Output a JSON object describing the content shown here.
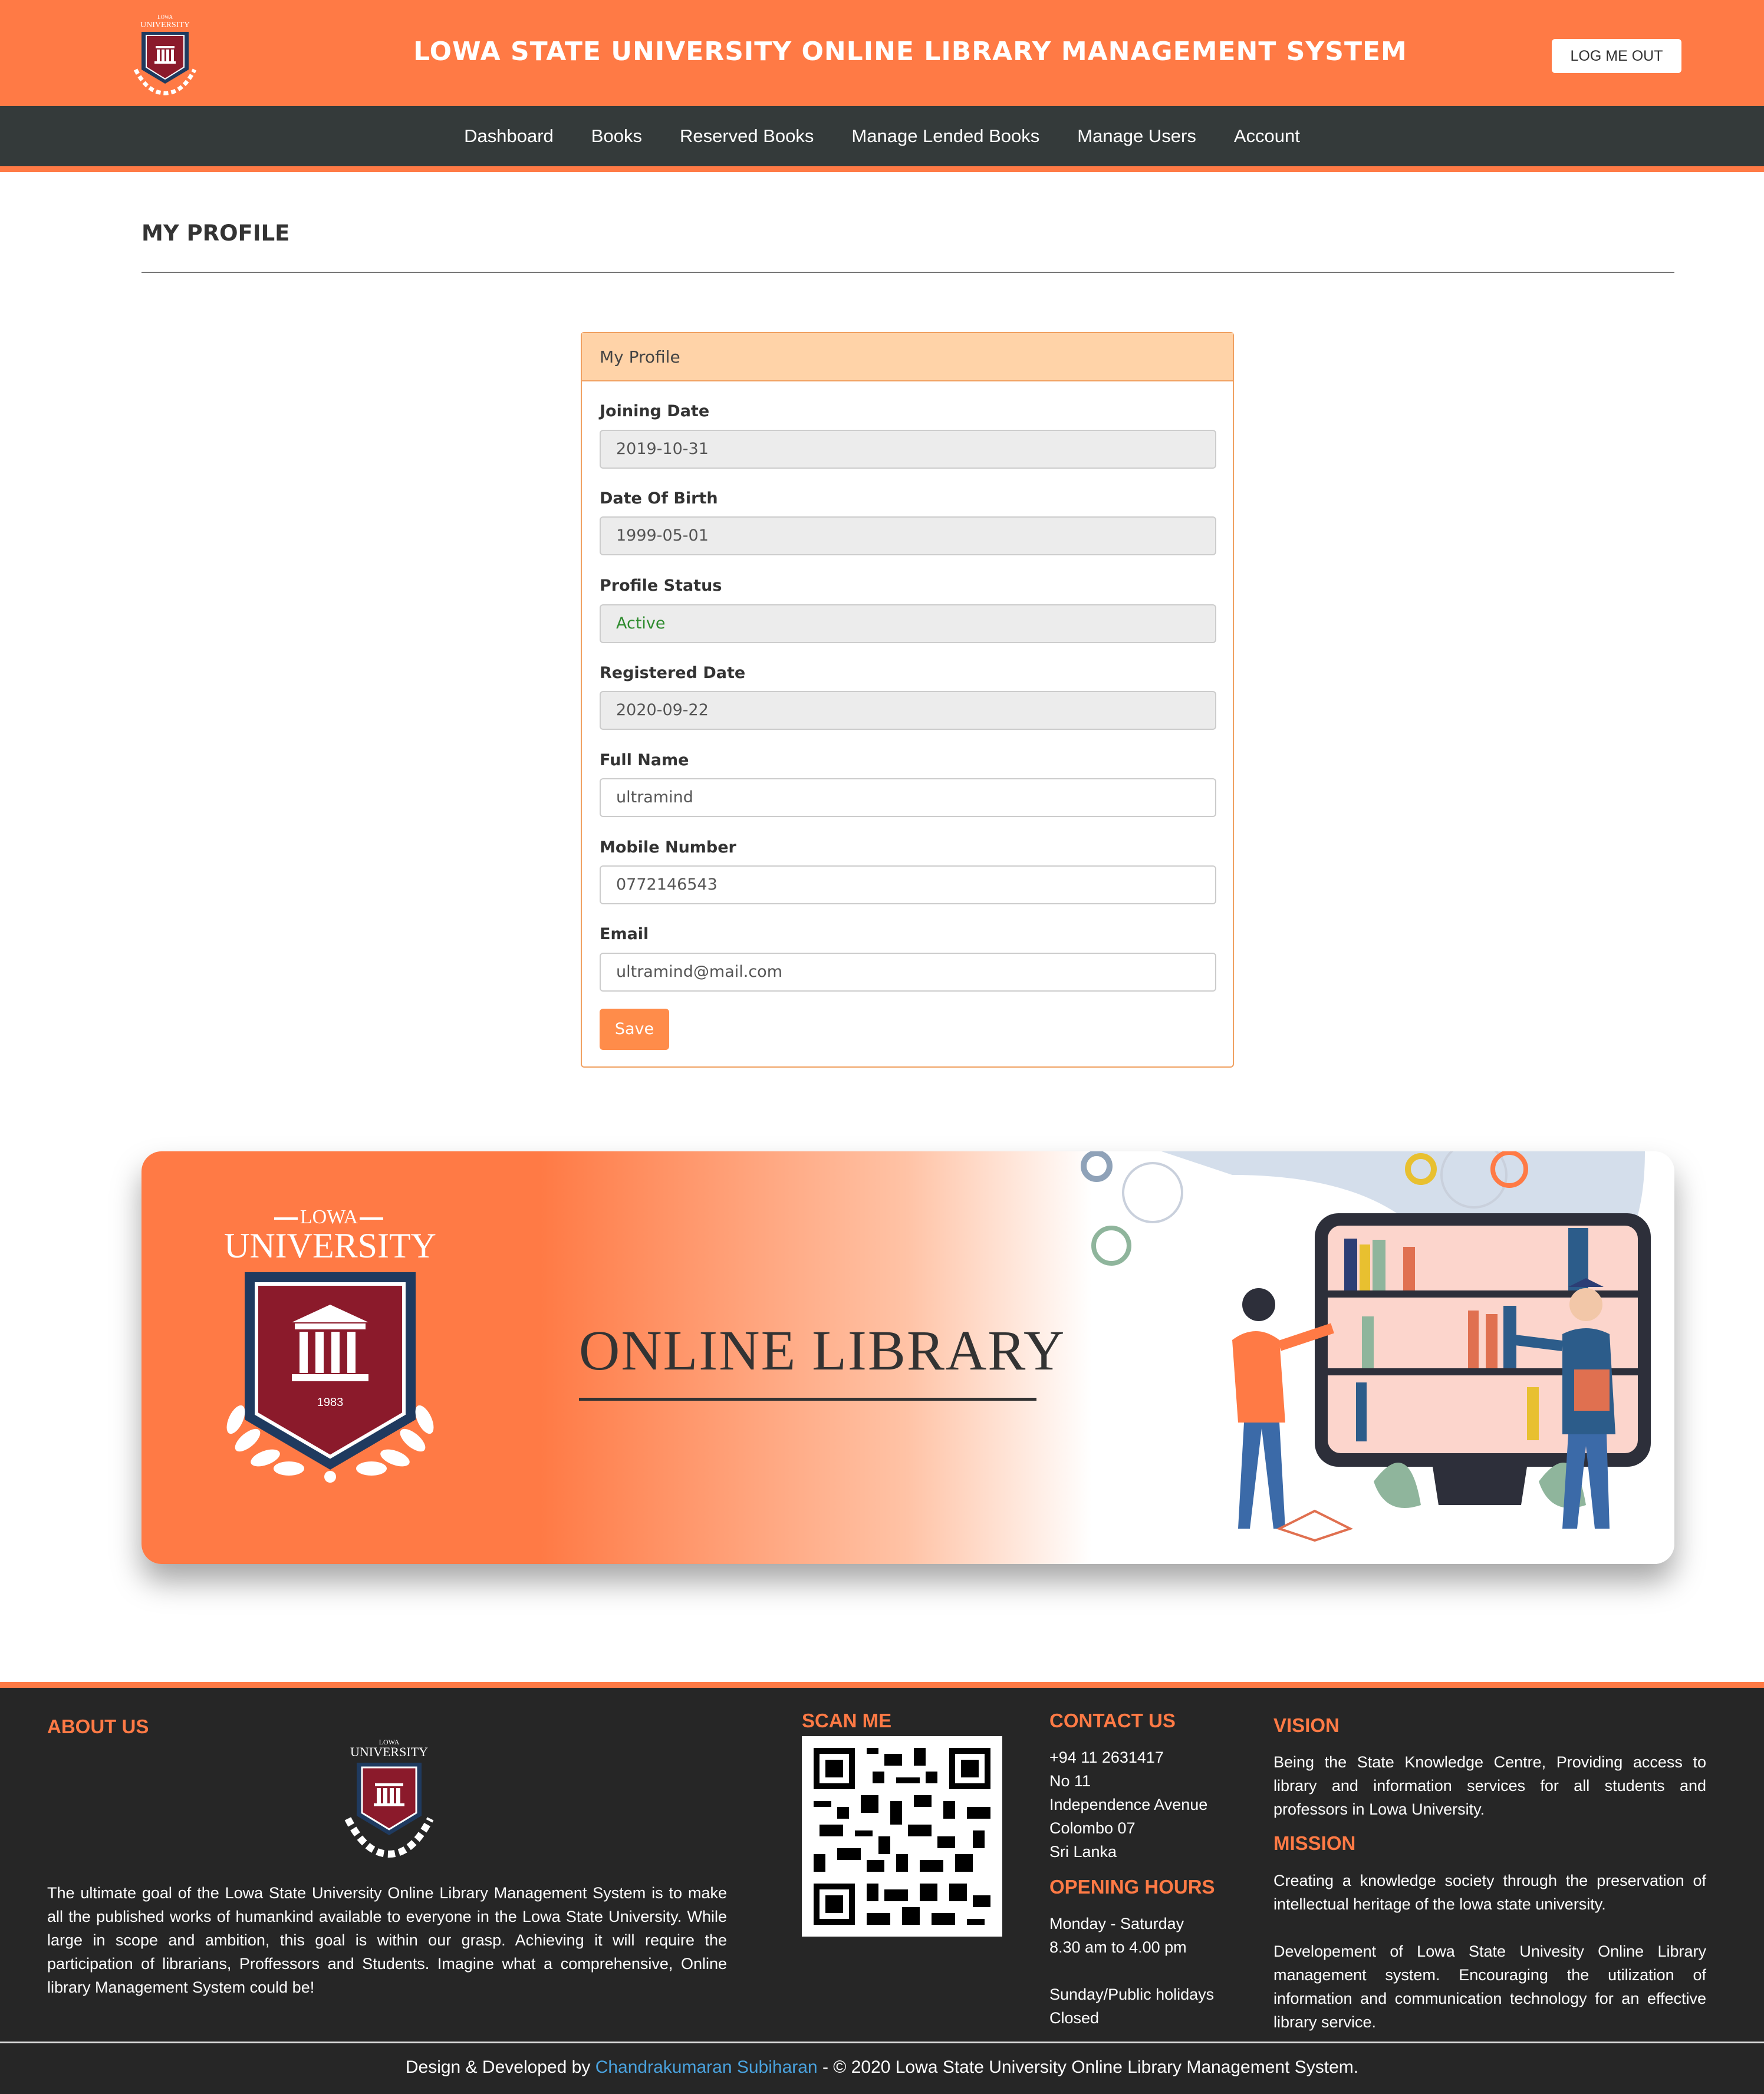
{
  "header": {
    "title": "LOWA STATE UNIVERSITY ONLINE LIBRARY MANAGEMENT SYSTEM",
    "logout_label": "LOG ME OUT",
    "logo": {
      "top_text": "LOWA",
      "main_text": "UNIVERSITY"
    }
  },
  "nav": {
    "items": [
      {
        "label": "Dashboard"
      },
      {
        "label": "Books"
      },
      {
        "label": "Reserved Books"
      },
      {
        "label": "Manage Lended Books"
      },
      {
        "label": "Manage Users"
      },
      {
        "label": "Account"
      }
    ]
  },
  "page": {
    "heading": "MY PROFILE"
  },
  "profile_card": {
    "title": "My Profile",
    "fields": [
      {
        "label": "Joining Date",
        "value": "2019-10-31",
        "readonly": true
      },
      {
        "label": "Date Of Birth",
        "value": "1999-05-01",
        "readonly": true
      },
      {
        "label": "Profile Status",
        "value": "Active",
        "readonly": true,
        "color": "#2e8b2e"
      },
      {
        "label": "Registered Date",
        "value": "2020-09-22",
        "readonly": true
      },
      {
        "label": "Full Name",
        "value": "ultramind",
        "readonly": false
      },
      {
        "label": "Mobile Number",
        "value": "0772146543",
        "readonly": false
      },
      {
        "label": "Email",
        "value": "ultramind@mail.com",
        "readonly": false
      }
    ],
    "save_label": "Save"
  },
  "banner": {
    "logo_top": "LOWA",
    "logo_main": "UNIVERSITY",
    "logo_year": "1983",
    "title": "ONLINE LIBRARY"
  },
  "footer": {
    "about": {
      "heading": "ABOUT US",
      "logo_top": "LOWA",
      "logo_main": "UNIVERSITY",
      "text": "The ultimate goal of the Lowa State University Online Library Management System is to make all the published works of humankind available to everyone in the Lowa State University. While large in scope and ambition, this goal is within our grasp. Achieving it will require the participation of librarians, Proffessors and Students. Imagine what a comprehensive, Online library Management System could be!"
    },
    "scan": {
      "heading": "SCAN ME"
    },
    "contact": {
      "heading": "CONTACT US",
      "lines": [
        "+94 11 2631417",
        "No 11",
        "Independence Avenue",
        "Colombo 07",
        "Sri Lanka"
      ]
    },
    "hours": {
      "heading": "OPENING HOURS",
      "lines": [
        "Monday - Saturday",
        "8.30 am to 4.00 pm",
        "",
        "Sunday/Public holidays",
        "Closed"
      ]
    },
    "vision": {
      "heading": "VISION",
      "text": "Being the State Knowledge Centre, Providing access to library and information services for all students and professors in Lowa University."
    },
    "mission": {
      "heading": "MISSION",
      "text1": "Creating a knowledge society through the preservation of intellectual heritage of the lowa state university.",
      "text2": "Developement of Lowa State Univesity Online Library management system. Encouraging the utilization of information and communication technology for an effective library service."
    },
    "copyright": {
      "prefix": "Design & Developed by ",
      "author": "Chandrakumaran Subiharan",
      "suffix": " - © 2020 Lowa State University Online Library Management System."
    }
  },
  "colors": {
    "accent": "#ff7a45",
    "nav": "#343a3a",
    "footer": "#262626",
    "crest": "#8b1a2b",
    "shield": "#1f3a5f"
  }
}
